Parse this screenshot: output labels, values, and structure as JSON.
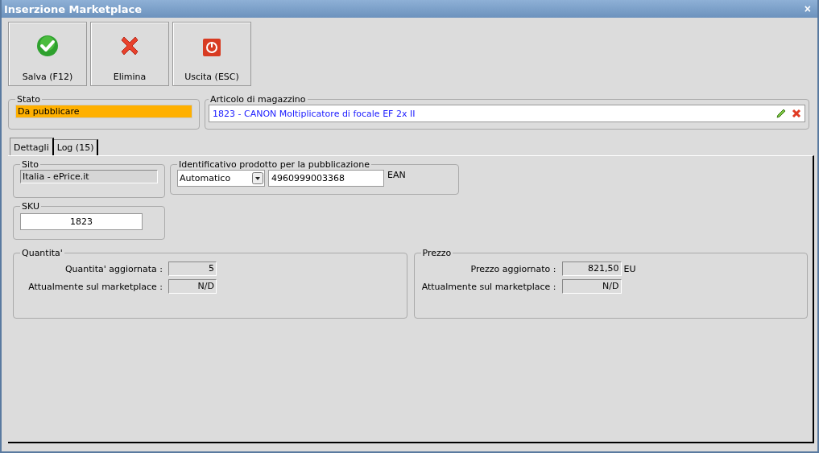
{
  "window": {
    "title": "Inserzione Marketplace",
    "close": "×"
  },
  "toolbar": [
    {
      "kind": "save",
      "label": "Salva (F12)"
    },
    {
      "kind": "delete",
      "label": "Elimina"
    },
    {
      "kind": "exit",
      "label": "Uscita (ESC)"
    }
  ],
  "stato": {
    "legend": "Stato",
    "value": "Da pubblicare"
  },
  "articolo": {
    "legend": "Articolo di magazzino",
    "value": "1823 - CANON Moltiplicatore di focale EF 2x II"
  },
  "tabs": [
    {
      "label": "Dettagli",
      "selected": true
    },
    {
      "label": "Log (15)",
      "selected": false
    }
  ],
  "sito": {
    "legend": "Sito",
    "value": "Italia - ePrice.it"
  },
  "identificativo": {
    "legend": "Identificativo prodotto per la pubblicazione",
    "select": "Automatico",
    "code": "4960999003368",
    "suffix": "EAN"
  },
  "sku": {
    "legend": "SKU",
    "value": "1823"
  },
  "panels": [
    {
      "legend": "Quantita'",
      "rows": [
        {
          "label": "Quantita' aggiornata :",
          "value": "5"
        },
        {
          "label": "Attualmente sul marketplace :",
          "value": "N/D"
        }
      ]
    },
    {
      "legend": "Prezzo",
      "rows": [
        {
          "label": "Prezzo aggiornato :",
          "value": "821,50",
          "unit": "EU"
        },
        {
          "label": "Attualmente sul marketplace :",
          "value": "N/D"
        }
      ]
    }
  ]
}
